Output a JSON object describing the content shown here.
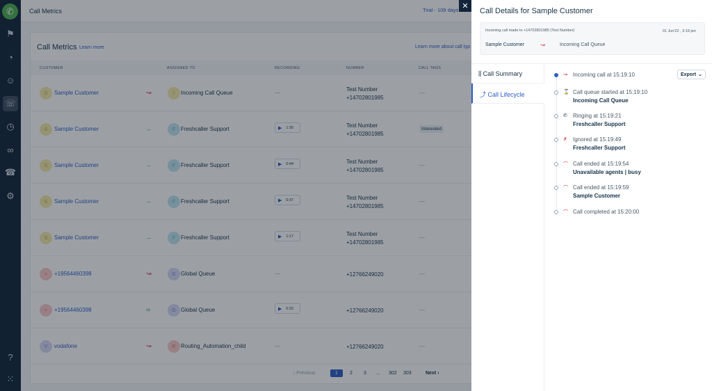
{
  "app": {
    "page_title": "Call Metrics",
    "trial": "Trial - 109 days"
  },
  "card": {
    "title": "Call Metrics",
    "learn_more": "Learn more",
    "learn_more_types": "Learn more about call typ"
  },
  "table": {
    "headers": [
      "CUSTOMER",
      "ASSIGNED TO",
      "RECORDING",
      "NUMBER",
      "CALL TAGS"
    ],
    "rows": [
      {
        "initial": "S",
        "customer": "Sample Customer",
        "direction": "missed",
        "agent_initial": "I",
        "assigned": "Incoming Call Queue",
        "recording": "—",
        "number": "Test Number",
        "number2": "+14702801985",
        "tag": "—"
      },
      {
        "initial": "S",
        "customer": "Sample Customer",
        "direction": "incoming",
        "agent_initial": "F",
        "assigned": "Freshcaller Support",
        "recording": "1:30",
        "number": "Test Number",
        "number2": "+14702801985",
        "tag": "Interested"
      },
      {
        "initial": "S",
        "customer": "Sample Customer",
        "direction": "incoming",
        "agent_initial": "F",
        "assigned": "Freshcaller Support",
        "recording": "0:44",
        "number": "Test Number",
        "number2": "+14702801985",
        "tag": "—"
      },
      {
        "initial": "S",
        "customer": "Sample Customer",
        "direction": "incoming",
        "agent_initial": "F",
        "assigned": "Freshcaller Support",
        "recording": "0:37",
        "number": "Test Number",
        "number2": "+14702801985",
        "tag": "—"
      },
      {
        "initial": "S",
        "customer": "Sample Customer",
        "direction": "incoming",
        "agent_initial": "F",
        "assigned": "Freshcaller Support",
        "recording": "1:17",
        "number": "Test Number",
        "number2": "+14702801985",
        "tag": "—"
      },
      {
        "initial": "+",
        "customer": "+19564460398",
        "direction": "missed",
        "agent_initial": "G",
        "assigned": "Global Queue",
        "recording": "—",
        "number": "+12766249020",
        "number2": "",
        "tag": "—"
      },
      {
        "initial": "+",
        "customer": "+19564460398",
        "direction": "voicemail",
        "agent_initial": "G",
        "assigned": "Global Queue",
        "recording": "0:32",
        "number": "+12766249020",
        "number2": "",
        "tag": "—"
      },
      {
        "initial": "V",
        "customer": "vodafone",
        "direction": "missed",
        "agent_initial": "R",
        "assigned": "Routing_Automation_child",
        "recording": "—",
        "number": "+12766249020",
        "number2": "",
        "tag": "—"
      }
    ]
  },
  "pagination": {
    "previous": "‹ Previous",
    "pages": [
      "1",
      "2",
      "3",
      "...",
      "302",
      "303"
    ],
    "current": "1",
    "next": "Next ›"
  },
  "panel": {
    "title": "Call Details for Sample Customer",
    "info_line": "Incoming call made to +14702801985 (Test Number)",
    "date": "01 Jun'22 , 3:19 pm",
    "from": "Sample Customer",
    "to": "Incoming Call Queue",
    "tabs": [
      {
        "label": "Call Summary",
        "icon": "bar-chart-icon"
      },
      {
        "label": "Call Lifecycle",
        "icon": "lifecycle-icon"
      }
    ],
    "export": "Export",
    "events": [
      {
        "text": "Incoming call at 15:19:10",
        "sub": "",
        "icon": "missed-call-icon"
      },
      {
        "text": "Call queue started at 15:19:10",
        "sub": "Incoming Call Queue",
        "icon": "queue-icon"
      },
      {
        "text": "Ringing at 15:19:21",
        "sub": "Freshcaller Support",
        "icon": "phone-icon"
      },
      {
        "text": "Ignored at 15:19:49",
        "sub": "Freshcaller Support",
        "icon": "ignored-icon"
      },
      {
        "text": "Call ended at 15:19:54",
        "sub": "Unavailable agents | busy",
        "icon": "hangup-icon"
      },
      {
        "text": "Call ended at 15:19:59",
        "sub": "Sample Customer",
        "icon": "hangup-icon"
      },
      {
        "text": "Call completed at 15:20:00",
        "sub": "",
        "icon": "hangup-icon"
      }
    ]
  },
  "colors": {
    "accent": "#2c5cc5",
    "sidebar": "#12253a",
    "missed": "#d72d30",
    "incoming": "#4caf50"
  }
}
